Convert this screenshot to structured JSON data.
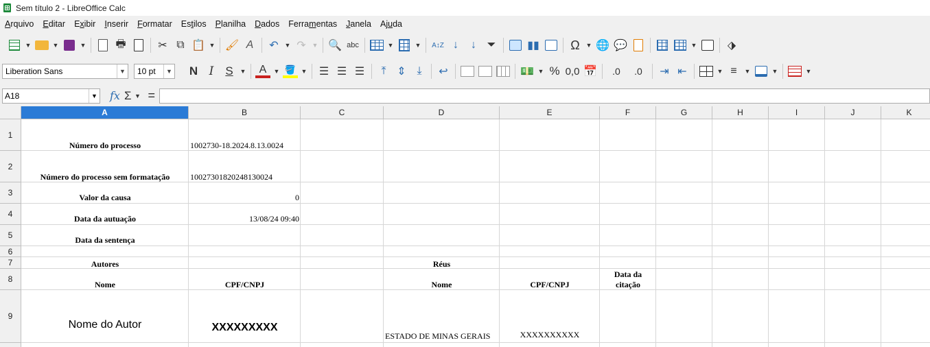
{
  "window": {
    "title": "Sem título 2 - LibreOffice Calc"
  },
  "menu": [
    {
      "pre": "",
      "u": "A",
      "post": "rquivo"
    },
    {
      "pre": "",
      "u": "E",
      "post": "ditar"
    },
    {
      "pre": "E",
      "u": "x",
      "post": "ibir"
    },
    {
      "pre": "",
      "u": "I",
      "post": "nserir"
    },
    {
      "pre": "",
      "u": "F",
      "post": "ormatar"
    },
    {
      "pre": "Es",
      "u": "t",
      "post": "ilos"
    },
    {
      "pre": "",
      "u": "P",
      "post": "lanilha"
    },
    {
      "pre": "",
      "u": "D",
      "post": "ados"
    },
    {
      "pre": "Ferra",
      "u": "m",
      "post": "entas"
    },
    {
      "pre": "",
      "u": "J",
      "post": "anela"
    },
    {
      "pre": "Aj",
      "u": "u",
      "post": "da"
    }
  ],
  "format_toolbar": {
    "font_name": "Liberation Sans",
    "font_size": "10 pt",
    "bold": "N",
    "italic": "I",
    "shadow": "S",
    "font_color_letter": "A",
    "percent": "%",
    "number_format": "0,0",
    "add_decimal": ".0",
    "del_decimal": ".0",
    "font_color": "#c9211e",
    "highlight_color": "#ffff00"
  },
  "toolbar_glyphs": {
    "spelling": "abc",
    "special_char": "Ω"
  },
  "formula_bar": {
    "name_box": "A18",
    "fx": "fx",
    "sigma": "Σ",
    "equals": "=",
    "content": ""
  },
  "columns": [
    "A",
    "B",
    "C",
    "D",
    "E",
    "F",
    "G",
    "H",
    "I",
    "J",
    "K"
  ],
  "rows": [
    "1",
    "2",
    "3",
    "4",
    "5",
    "6",
    "7",
    "8",
    "9"
  ],
  "cells": {
    "A1": "Número do processo",
    "B1": "1002730-18.2024.8.13.0024",
    "A2": "Número do processo sem formatação",
    "B2": "10027301820248130024",
    "A3": "Valor da causa",
    "B3": "0",
    "A4": "Data da autuação",
    "B4": "13/08/24 09:40",
    "A5": "Data da sentença",
    "A7": "Autores",
    "D7": "Réus",
    "A8": "Nome",
    "B8": "CPF/CNPJ",
    "D8": "Nome",
    "E8": "CPF/CNPJ",
    "F8a": "Data da",
    "F8b": "citação",
    "A9": "Nome do Autor",
    "B9": "XXXXXXXXX",
    "D9": "ESTADO DE MINAS GERAIS",
    "E9": "XXXXXXXXXX"
  },
  "selected_column": "A"
}
